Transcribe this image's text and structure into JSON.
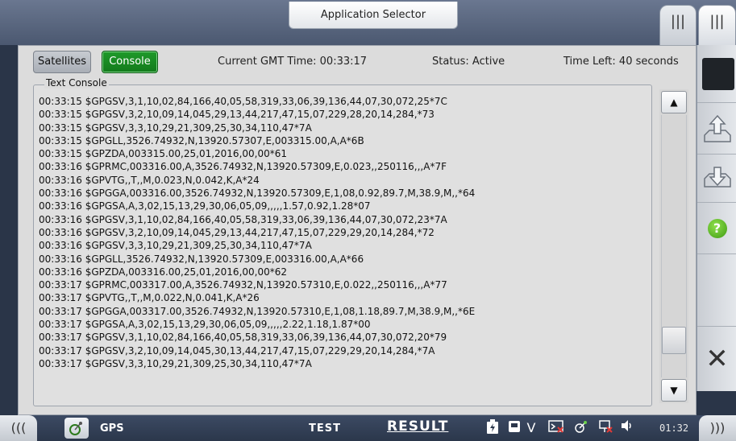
{
  "header": {
    "app_selector_label": "Application Selector",
    "tab_a_icon": "|||",
    "tab_b_icon": "|||"
  },
  "toolbar": {
    "satellites_label": "Satellites",
    "console_label": "Console",
    "current_time": "Current GMT Time: 00:33:17",
    "status": "Status: Active",
    "time_left": "Time Left: 40 seconds"
  },
  "console": {
    "legend": "Text Console",
    "lines": [
      "00:33:15 $GPGSV,3,1,10,02,84,166,40,05,58,319,33,06,39,136,44,07,30,072,25*7C",
      "00:33:15 $GPGSV,3,2,10,09,14,045,29,13,44,217,47,15,07,229,28,20,14,284,*73",
      "00:33:15 $GPGSV,3,3,10,29,21,309,25,30,34,110,47*7A",
      "00:33:15 $GPGLL,3526.74932,N,13920.57307,E,003315.00,A,A*6B",
      "00:33:15 $GPZDA,003315.00,25,01,2016,00,00*61",
      "00:33:16 $GPRMC,003316.00,A,3526.74932,N,13920.57309,E,0.023,,250116,,,A*7F",
      "00:33:16 $GPVTG,,T,,M,0.023,N,0.042,K,A*24",
      "00:33:16 $GPGGA,003316.00,3526.74932,N,13920.57309,E,1,08,0.92,89.7,M,38.9,M,,*64",
      "00:33:16 $GPGSA,A,3,02,15,13,29,30,06,05,09,,,,,1.57,0.92,1.28*07",
      "00:33:16 $GPGSV,3,1,10,02,84,166,40,05,58,319,33,06,39,136,44,07,30,072,23*7A",
      "00:33:16 $GPGSV,3,2,10,09,14,045,29,13,44,217,47,15,07,229,29,20,14,284,*72",
      "00:33:16 $GPGSV,3,3,10,29,21,309,25,30,34,110,47*7A",
      "00:33:16 $GPGLL,3526.74932,N,13920.57309,E,003316.00,A,A*66",
      "00:33:16 $GPZDA,003316.00,25,01,2016,00,00*62",
      "00:33:17 $GPRMC,003317.00,A,3526.74932,N,13920.57310,E,0.022,,250116,,,A*77",
      "00:33:17 $GPVTG,,T,,M,0.022,N,0.041,K,A*26",
      "00:33:17 $GPGGA,003317.00,3526.74932,N,13920.57310,E,1,08,1.18,89.7,M,38.9,M,,*6E",
      "00:33:17 $GPGSA,A,3,02,15,13,29,30,06,05,09,,,,,2.22,1.18,1.87*00",
      "00:33:17 $GPGSV,3,1,10,02,84,166,40,05,58,319,33,06,39,136,44,07,30,072,20*79",
      "00:33:17 $GPGSV,3,2,10,09,14,045,30,13,44,217,47,15,07,229,29,20,14,284,*7A",
      "00:33:17 $GPGSV,3,3,10,29,21,309,25,30,34,110,47*7A"
    ],
    "scroll_position": 0.9
  },
  "side_panel": {
    "help_label": "?",
    "close_label": "✕"
  },
  "statusbar": {
    "left_chevron": "(((",
    "right_chevron": ")))",
    "app_name": "GPS",
    "test_label": "TEST",
    "result_label": "RESULT",
    "clock": "01:32",
    "tray_icons": [
      "battery-charging-icon",
      "memory-icon",
      "v-icon",
      "terminal-icon",
      "satellite-icon",
      "network-icon",
      "speaker-icon"
    ]
  },
  "colors": {
    "console_active": "#1b8a24",
    "help_green": "#5bbf22",
    "top_bar": "#5a667f"
  }
}
